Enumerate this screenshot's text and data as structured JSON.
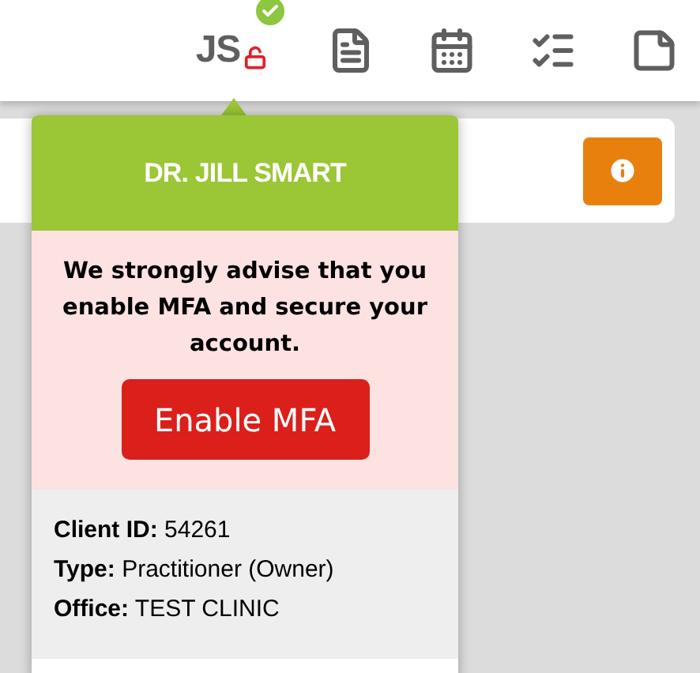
{
  "topbar": {
    "user": {
      "initials": "JS",
      "verified": true,
      "mfa_enabled": false
    },
    "icons": [
      {
        "kind": "document"
      },
      {
        "kind": "calendar"
      },
      {
        "kind": "checklist"
      },
      {
        "kind": "note"
      }
    ]
  },
  "popup": {
    "name": "DR. JILL SMART",
    "warning": "We strongly advise that you enable MFA and secure your account.",
    "action": "Enable MFA",
    "details": [
      "**Client ID:** 54261",
      "**Type:** Practitioner (Owner)",
      "**Office:** TEST CLINIC"
    ]
  }
}
